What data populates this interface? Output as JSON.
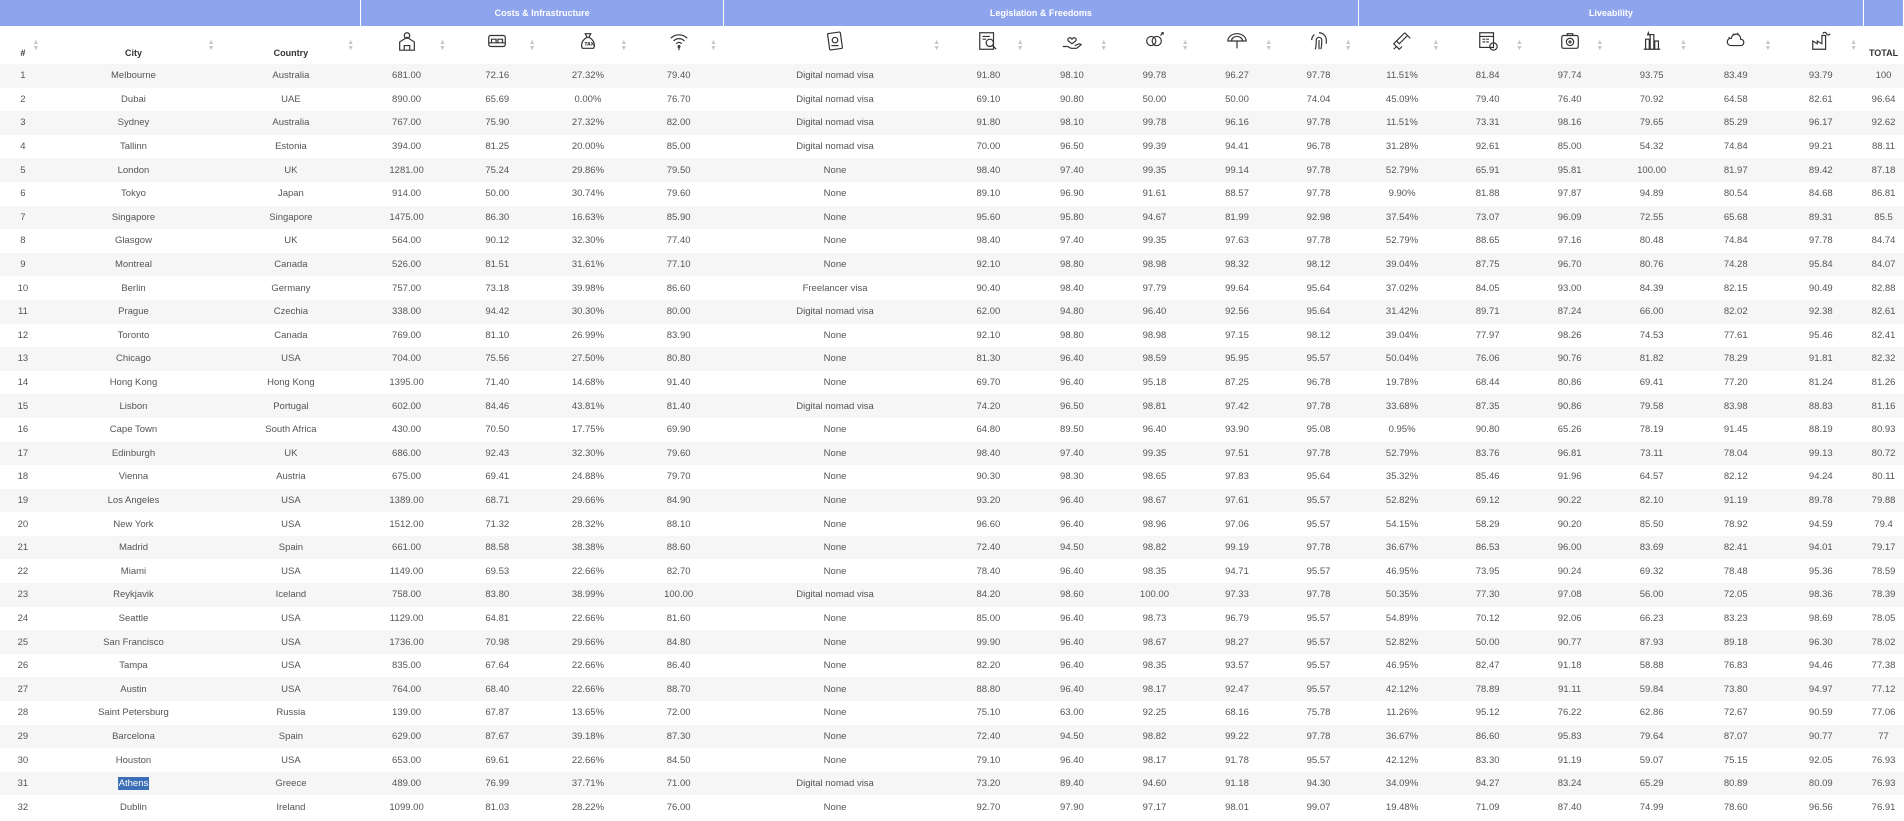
{
  "groups": {
    "costs": "Costs & Infrastructure",
    "legislation": "Legislation & Freedoms",
    "liveability": "Liveability"
  },
  "columns": {
    "rank": "#",
    "city": "City",
    "country": "Country",
    "total": "TOTAL"
  },
  "column_icons": [
    "housing-cost-icon",
    "hotel-bed-icon",
    "tax-bag-icon",
    "wifi-speed-icon",
    "visa-passport-icon",
    "search-document-icon",
    "hand-heart-icon",
    "gender-equality-icon",
    "rainbow-umbrella-icon",
    "fingerprint-icon",
    "vaccine-icon",
    "calendar-calculator-icon",
    "medical-kit-icon",
    "city-skyline-icon",
    "weather-cloud-icon",
    "factory-pollution-icon"
  ],
  "selected_city": "Athens",
  "rows": [
    [
      "1",
      "Melbourne",
      "Australia",
      "681.00",
      "72.16",
      "27.32%",
      "79.40",
      "Digital nomad visa",
      "91.80",
      "98.10",
      "99.78",
      "96.27",
      "97.78",
      "11.51%",
      "81.84",
      "97.74",
      "93.75",
      "83.49",
      "93.79",
      "100"
    ],
    [
      "2",
      "Dubai",
      "UAE",
      "890.00",
      "65.69",
      "0.00%",
      "76.70",
      "Digital nomad visa",
      "69.10",
      "90.80",
      "50.00",
      "50.00",
      "74.04",
      "45.09%",
      "79.40",
      "76.40",
      "70.92",
      "64.58",
      "82.61",
      "96.64"
    ],
    [
      "3",
      "Sydney",
      "Australia",
      "767.00",
      "75.90",
      "27.32%",
      "82.00",
      "Digital nomad visa",
      "91.80",
      "98.10",
      "99.78",
      "96.16",
      "97.78",
      "11.51%",
      "73.31",
      "98.16",
      "79.65",
      "85.29",
      "96.17",
      "92.62"
    ],
    [
      "4",
      "Tallinn",
      "Estonia",
      "394.00",
      "81.25",
      "20.00%",
      "85.00",
      "Digital nomad visa",
      "70.00",
      "96.50",
      "99.39",
      "94.41",
      "96.78",
      "31.28%",
      "92.61",
      "85.00",
      "54.32",
      "74.84",
      "99.21",
      "88.11"
    ],
    [
      "5",
      "London",
      "UK",
      "1281.00",
      "75.24",
      "29.86%",
      "79.50",
      "None",
      "98.40",
      "97.40",
      "99.35",
      "99.14",
      "97.78",
      "52.79%",
      "65.91",
      "95.81",
      "100.00",
      "81.97",
      "89.42",
      "87.18"
    ],
    [
      "6",
      "Tokyo",
      "Japan",
      "914.00",
      "50.00",
      "30.74%",
      "79.60",
      "None",
      "89.10",
      "96.90",
      "91.61",
      "88.57",
      "97.78",
      "9.90%",
      "81.88",
      "97.87",
      "94.89",
      "80.54",
      "84.68",
      "86.81"
    ],
    [
      "7",
      "Singapore",
      "Singapore",
      "1475.00",
      "86.30",
      "16.63%",
      "85.90",
      "None",
      "95.60",
      "95.80",
      "94.67",
      "81.99",
      "92.98",
      "37.54%",
      "73.07",
      "96.09",
      "72.55",
      "65.68",
      "89.31",
      "85.5"
    ],
    [
      "8",
      "Glasgow",
      "UK",
      "564.00",
      "90.12",
      "32.30%",
      "77.40",
      "None",
      "98.40",
      "97.40",
      "99.35",
      "97.63",
      "97.78",
      "52.79%",
      "88.65",
      "97.16",
      "80.48",
      "74.84",
      "97.78",
      "84.74"
    ],
    [
      "9",
      "Montreal",
      "Canada",
      "526.00",
      "81.51",
      "31.61%",
      "77.10",
      "None",
      "92.10",
      "98.80",
      "98.98",
      "98.32",
      "98.12",
      "39.04%",
      "87.75",
      "96.70",
      "80.76",
      "74.28",
      "95.84",
      "84.07"
    ],
    [
      "10",
      "Berlin",
      "Germany",
      "757.00",
      "73.18",
      "39.98%",
      "86.60",
      "Freelancer visa",
      "90.40",
      "98.40",
      "97.79",
      "99.64",
      "95.64",
      "37.02%",
      "84.05",
      "93.00",
      "84.39",
      "82.15",
      "90.49",
      "82.88"
    ],
    [
      "11",
      "Prague",
      "Czechia",
      "338.00",
      "94.42",
      "30.30%",
      "80.00",
      "Digital nomad visa",
      "62.00",
      "94.80",
      "96.40",
      "92.56",
      "95.64",
      "31.42%",
      "89.71",
      "87.24",
      "66.00",
      "82.02",
      "92.38",
      "82.61"
    ],
    [
      "12",
      "Toronto",
      "Canada",
      "769.00",
      "81.10",
      "26.99%",
      "83.90",
      "None",
      "92.10",
      "98.80",
      "98.98",
      "97.15",
      "98.12",
      "39.04%",
      "77.97",
      "98.26",
      "74.53",
      "77.61",
      "95.46",
      "82.41"
    ],
    [
      "13",
      "Chicago",
      "USA",
      "704.00",
      "75.56",
      "27.50%",
      "80.80",
      "None",
      "81.30",
      "96.40",
      "98.59",
      "95.95",
      "95.57",
      "50.04%",
      "76.06",
      "90.76",
      "81.82",
      "78.29",
      "91.81",
      "82.32"
    ],
    [
      "14",
      "Hong Kong",
      "Hong Kong",
      "1395.00",
      "71.40",
      "14.68%",
      "91.40",
      "None",
      "69.70",
      "96.40",
      "95.18",
      "87.25",
      "96.78",
      "19.78%",
      "68.44",
      "80.86",
      "69.41",
      "77.20",
      "81.24",
      "81.26"
    ],
    [
      "15",
      "Lisbon",
      "Portugal",
      "602.00",
      "84.46",
      "43.81%",
      "81.40",
      "Digital nomad visa",
      "74.20",
      "96.50",
      "98.81",
      "97.42",
      "97.78",
      "33.68%",
      "87.35",
      "90.86",
      "79.58",
      "83.98",
      "88.83",
      "81.16"
    ],
    [
      "16",
      "Cape Town",
      "South Africa",
      "430.00",
      "70.50",
      "17.75%",
      "69.90",
      "None",
      "64.80",
      "89.50",
      "96.40",
      "93.90",
      "95.08",
      "0.95%",
      "90.80",
      "65.26",
      "78.19",
      "91.45",
      "88.19",
      "80.93"
    ],
    [
      "17",
      "Edinburgh",
      "UK",
      "686.00",
      "92.43",
      "32.30%",
      "79.60",
      "None",
      "98.40",
      "97.40",
      "99.35",
      "97.51",
      "97.78",
      "52.79%",
      "83.76",
      "96.81",
      "73.11",
      "78.04",
      "99.13",
      "80.72"
    ],
    [
      "18",
      "Vienna",
      "Austria",
      "675.00",
      "69.41",
      "24.88%",
      "79.70",
      "None",
      "90.30",
      "98.30",
      "98.65",
      "97.83",
      "95.64",
      "35.32%",
      "85.46",
      "91.96",
      "64.57",
      "82.12",
      "94.24",
      "80.11"
    ],
    [
      "19",
      "Los Angeles",
      "USA",
      "1389.00",
      "68.71",
      "29.66%",
      "84.90",
      "None",
      "93.20",
      "96.40",
      "98.67",
      "97.61",
      "95.57",
      "52.82%",
      "69.12",
      "90.22",
      "82.10",
      "91.19",
      "89.78",
      "79.88"
    ],
    [
      "20",
      "New York",
      "USA",
      "1512.00",
      "71.32",
      "28.32%",
      "88.10",
      "None",
      "96.60",
      "96.40",
      "98.96",
      "97.06",
      "95.57",
      "54.15%",
      "58.29",
      "90.20",
      "85.50",
      "78.92",
      "94.59",
      "79.4"
    ],
    [
      "21",
      "Madrid",
      "Spain",
      "661.00",
      "88.58",
      "38.38%",
      "88.60",
      "None",
      "72.40",
      "94.50",
      "98.82",
      "99.19",
      "97.78",
      "36.67%",
      "86.53",
      "96.00",
      "83.69",
      "82.41",
      "94.01",
      "79.17"
    ],
    [
      "22",
      "Miami",
      "USA",
      "1149.00",
      "69.53",
      "22.66%",
      "82.70",
      "None",
      "78.40",
      "96.40",
      "98.35",
      "94.71",
      "95.57",
      "46.95%",
      "73.95",
      "90.24",
      "69.32",
      "78.48",
      "95.36",
      "78.59"
    ],
    [
      "23",
      "Reykjavik",
      "Iceland",
      "758.00",
      "83.80",
      "38.99%",
      "100.00",
      "Digital nomad visa",
      "84.20",
      "98.60",
      "100.00",
      "97.33",
      "97.78",
      "50.35%",
      "77.30",
      "97.08",
      "56.00",
      "72.05",
      "98.36",
      "78.39"
    ],
    [
      "24",
      "Seattle",
      "USA",
      "1129.00",
      "64.81",
      "22.66%",
      "81.60",
      "None",
      "85.00",
      "96.40",
      "98.73",
      "96.79",
      "95.57",
      "54.89%",
      "70.12",
      "92.06",
      "66.23",
      "83.23",
      "98.69",
      "78.05"
    ],
    [
      "25",
      "San Francisco",
      "USA",
      "1736.00",
      "70.98",
      "29.66%",
      "84.80",
      "None",
      "99.90",
      "96.40",
      "98.67",
      "98.27",
      "95.57",
      "52.82%",
      "50.00",
      "90.77",
      "87.93",
      "89.18",
      "96.30",
      "78.02"
    ],
    [
      "26",
      "Tampa",
      "USA",
      "835.00",
      "67.64",
      "22.66%",
      "86.40",
      "None",
      "82.20",
      "96.40",
      "98.35",
      "93.57",
      "95.57",
      "46.95%",
      "82.47",
      "91.18",
      "58.88",
      "76.83",
      "94.46",
      "77.38"
    ],
    [
      "27",
      "Austin",
      "USA",
      "764.00",
      "68.40",
      "22.66%",
      "88.70",
      "None",
      "88.80",
      "96.40",
      "98.17",
      "92.47",
      "95.57",
      "42.12%",
      "78.89",
      "91.11",
      "59.84",
      "73.80",
      "94.97",
      "77.12"
    ],
    [
      "28",
      "Saint Petersburg",
      "Russia",
      "139.00",
      "67.87",
      "13.65%",
      "72.00",
      "None",
      "75.10",
      "63.00",
      "92.25",
      "68.16",
      "75.78",
      "11.26%",
      "95.12",
      "76.22",
      "62.86",
      "72.67",
      "90.59",
      "77.06"
    ],
    [
      "29",
      "Barcelona",
      "Spain",
      "629.00",
      "87.67",
      "39.18%",
      "87.30",
      "None",
      "72.40",
      "94.50",
      "98.82",
      "99.22",
      "97.78",
      "36.67%",
      "86.60",
      "95.83",
      "79.64",
      "87.07",
      "90.77",
      "77"
    ],
    [
      "30",
      "Houston",
      "USA",
      "653.00",
      "69.61",
      "22.66%",
      "84.50",
      "None",
      "79.10",
      "96.40",
      "98.17",
      "91.78",
      "95.57",
      "42.12%",
      "83.30",
      "91.19",
      "59.07",
      "75.15",
      "92.05",
      "76.93"
    ],
    [
      "31",
      "Athens",
      "Greece",
      "489.00",
      "76.99",
      "37.71%",
      "71.00",
      "Digital nomad visa",
      "73.20",
      "89.40",
      "94.60",
      "91.18",
      "94.30",
      "34.09%",
      "94.27",
      "83.24",
      "65.29",
      "80.89",
      "80.09",
      "76.93"
    ],
    [
      "32",
      "Dublin",
      "Ireland",
      "1099.00",
      "81.03",
      "28.22%",
      "76.00",
      "None",
      "92.70",
      "97.90",
      "97.17",
      "98.01",
      "99.07",
      "19.48%",
      "71.09",
      "87.40",
      "74.99",
      "78.60",
      "96.56",
      "76.91"
    ]
  ]
}
